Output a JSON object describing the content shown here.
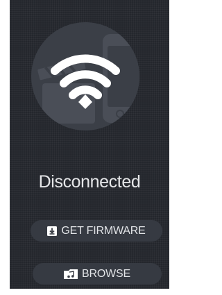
{
  "connection": {
    "status_text": "Disconnected",
    "status_icon": "wifi-icon"
  },
  "actions": {
    "get_firmware_label": "GET FIRMWARE",
    "get_firmware_icon": "download-icon",
    "browse_label": "BROWSE",
    "browse_icon": "music-folder-icon"
  },
  "colors": {
    "background": "#24272d",
    "hero_circle": "#3b3f47",
    "button_bg": "#363a42",
    "text": "#e6e7e9"
  }
}
